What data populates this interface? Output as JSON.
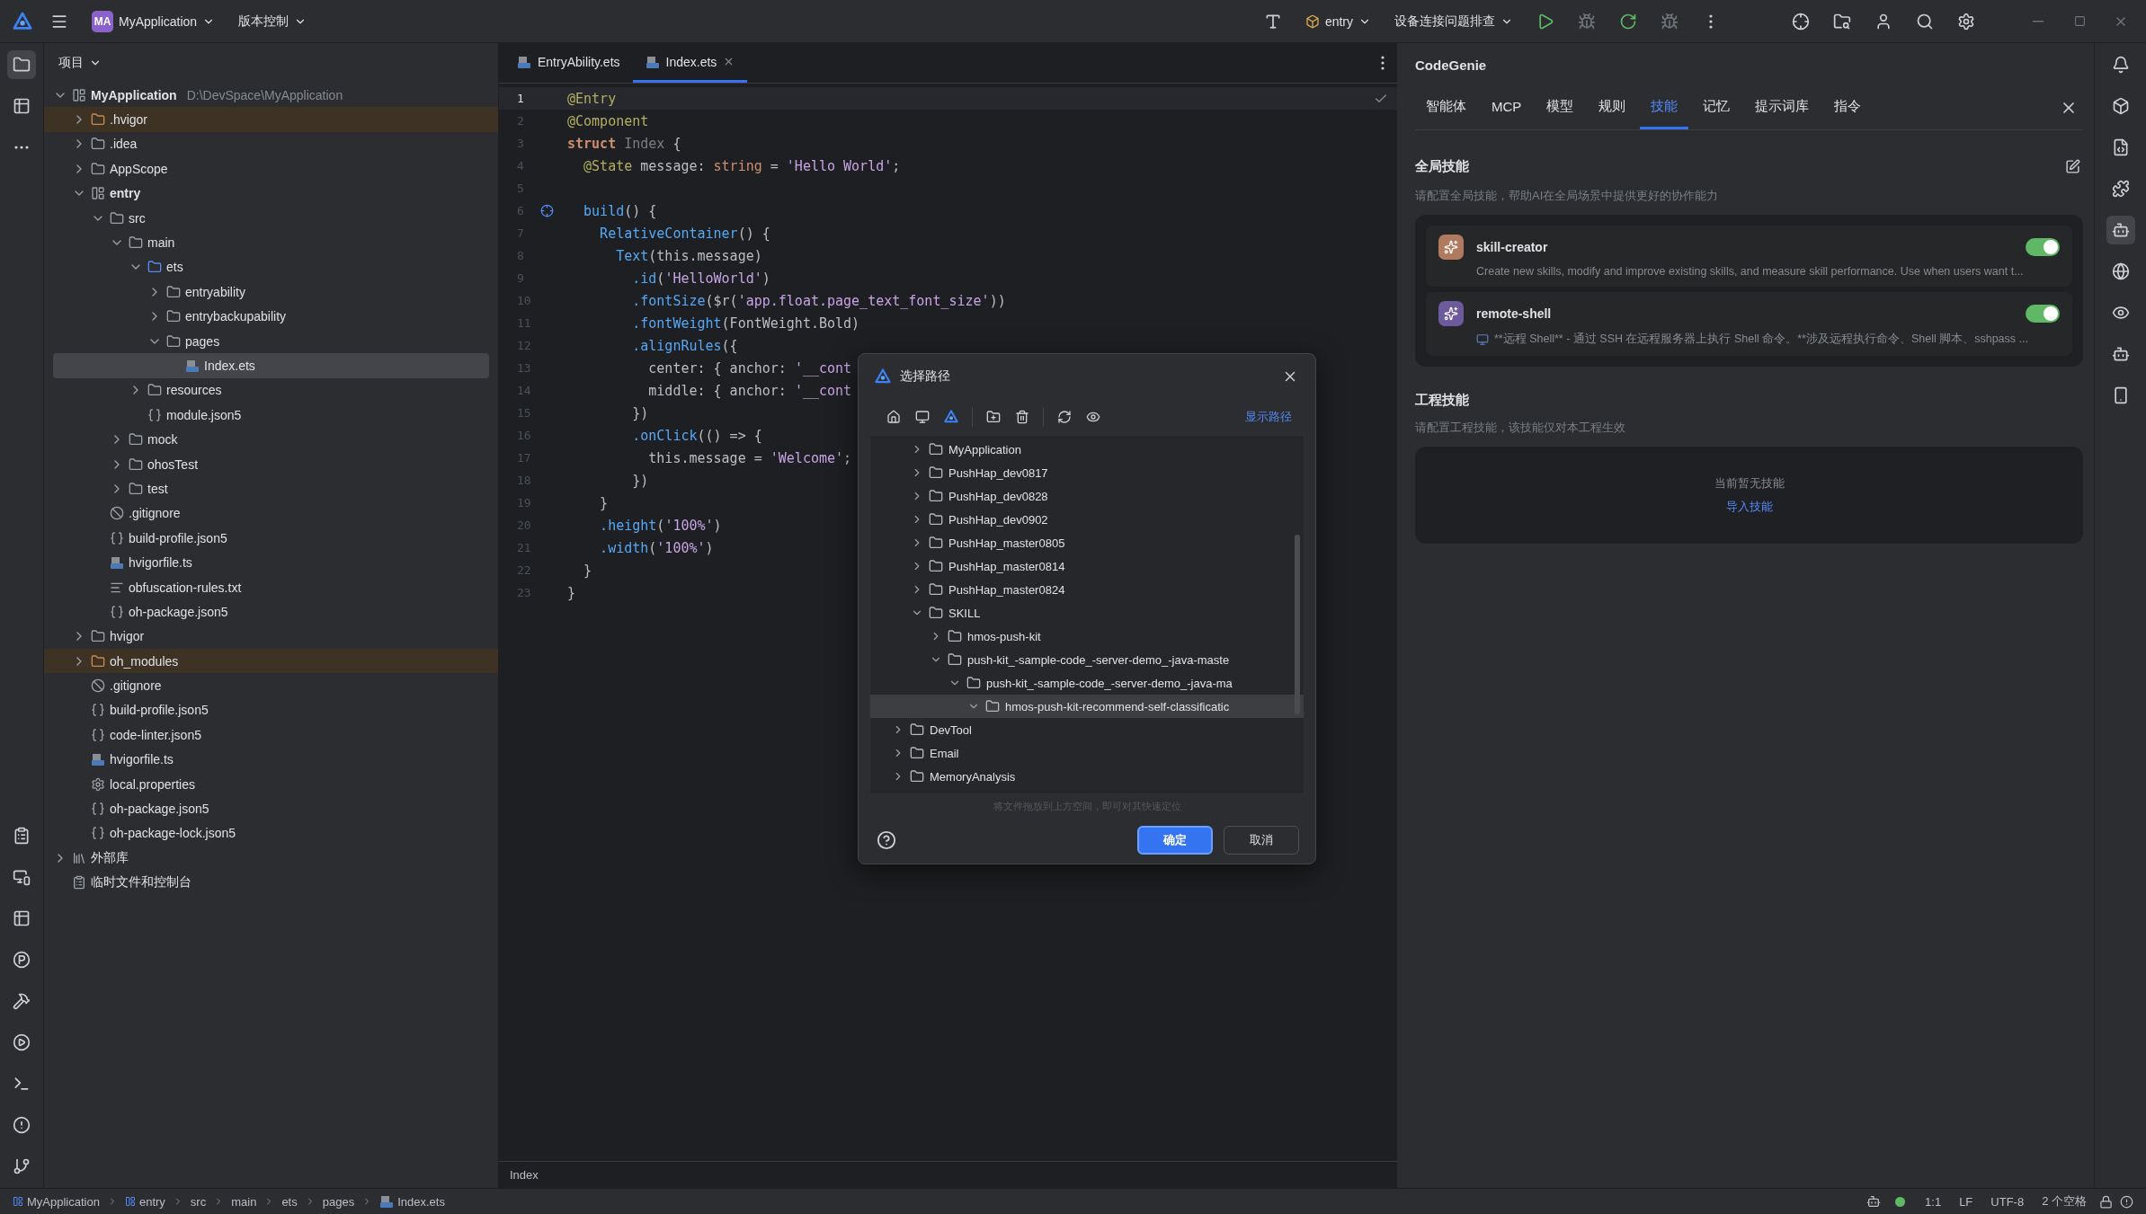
{
  "titlebar": {
    "project_badge": "MA",
    "project": "MyApplication",
    "vcs": "版本控制",
    "run_config": "entry",
    "device": "设备连接问题排查"
  },
  "project_panel": {
    "title": "项目",
    "tree": [
      {
        "name": "MyApplication",
        "kind": "module",
        "path": "D:\\DevSpace\\MyApplication",
        "expanded": true,
        "selected": false,
        "excluded": false,
        "children": [
          {
            "name": ".hvigor",
            "kind": "folder",
            "expanded": false,
            "selected": false,
            "excluded": true
          },
          {
            "name": ".idea",
            "kind": "folder",
            "expanded": false,
            "selected": false,
            "excluded": false
          },
          {
            "name": "AppScope",
            "kind": "folder",
            "expanded": false,
            "selected": false,
            "excluded": false
          },
          {
            "name": "entry",
            "kind": "module",
            "expanded": true,
            "selected": false,
            "excluded": false,
            "children": [
              {
                "name": "src",
                "kind": "folder",
                "expanded": true,
                "selected": false,
                "excluded": false,
                "children": [
                  {
                    "name": "main",
                    "kind": "folder",
                    "expanded": true,
                    "selected": false,
                    "excluded": false,
                    "children": [
                      {
                        "name": "ets",
                        "kind": "source",
                        "expanded": true,
                        "selected": false,
                        "excluded": false,
                        "children": [
                          {
                            "name": "entryability",
                            "kind": "folder",
                            "expanded": false,
                            "selected": false,
                            "excluded": false
                          },
                          {
                            "name": "entrybackupability",
                            "kind": "folder",
                            "expanded": false,
                            "selected": false,
                            "excluded": false
                          },
                          {
                            "name": "pages",
                            "kind": "folder",
                            "expanded": true,
                            "selected": false,
                            "excluded": false,
                            "children": [
                              {
                                "name": "Index.ets",
                                "kind": "ets",
                                "selected": true,
                                "excluded": false
                              }
                            ]
                          }
                        ]
                      },
                      {
                        "name": "resources",
                        "kind": "folder",
                        "expanded": false,
                        "selected": false,
                        "excluded": false
                      },
                      {
                        "name": "module.json5",
                        "kind": "json",
                        "selected": false,
                        "excluded": false
                      }
                    ]
                  },
                  {
                    "name": "mock",
                    "kind": "folder",
                    "expanded": false,
                    "selected": false,
                    "excluded": false
                  },
                  {
                    "name": "ohosTest",
                    "kind": "folder",
                    "expanded": false,
                    "selected": false,
                    "excluded": false
                  },
                  {
                    "name": "test",
                    "kind": "folder",
                    "expanded": false,
                    "selected": false,
                    "excluded": false
                  }
                ]
              },
              {
                "name": ".gitignore",
                "kind": "ignore",
                "selected": false,
                "excluded": false
              },
              {
                "name": "build-profile.json5",
                "kind": "json",
                "selected": false,
                "excluded": false
              },
              {
                "name": "hvigorfile.ts",
                "kind": "ts",
                "selected": false,
                "excluded": false
              },
              {
                "name": "obfuscation-rules.txt",
                "kind": "text",
                "selected": false,
                "excluded": false
              },
              {
                "name": "oh-package.json5",
                "kind": "json",
                "selected": false,
                "excluded": false
              }
            ]
          },
          {
            "name": "hvigor",
            "kind": "folder",
            "expanded": false,
            "selected": false,
            "excluded": false
          },
          {
            "name": "oh_modules",
            "kind": "folder",
            "expanded": false,
            "selected": false,
            "excluded": true
          },
          {
            "name": ".gitignore",
            "kind": "ignore",
            "selected": false,
            "excluded": false
          },
          {
            "name": "build-profile.json5",
            "kind": "json",
            "selected": false,
            "excluded": false
          },
          {
            "name": "code-linter.json5",
            "kind": "json",
            "selected": false,
            "excluded": false
          },
          {
            "name": "hvigorfile.ts",
            "kind": "ts",
            "selected": false,
            "excluded": false
          },
          {
            "name": "local.properties",
            "kind": "settings",
            "selected": false,
            "excluded": false
          },
          {
            "name": "oh-package.json5",
            "kind": "json",
            "selected": false,
            "excluded": false
          },
          {
            "name": "oh-package-lock.json5",
            "kind": "json",
            "selected": false,
            "excluded": false
          }
        ]
      },
      {
        "name": "外部库",
        "kind": "library",
        "expanded": false,
        "selected": false,
        "excluded": false
      },
      {
        "name": "临时文件和控制台",
        "kind": "scratch",
        "selected": false,
        "excluded": false
      }
    ]
  },
  "editor": {
    "tabs": [
      {
        "label": "EntryAbility.ets",
        "selected": false,
        "closable": false
      },
      {
        "label": "Index.ets",
        "selected": true,
        "closable": true
      }
    ],
    "lines": [
      {
        "n": "1",
        "current": true,
        "gutter_icon": false,
        "tokens": [
          {
            "kind": "ann",
            "text": "@Entry"
          }
        ]
      },
      {
        "n": "2",
        "current": false,
        "gutter_icon": false,
        "tokens": [
          {
            "kind": "ann",
            "text": "@Component"
          }
        ]
      },
      {
        "n": "3",
        "current": false,
        "gutter_icon": false,
        "tokens": [
          {
            "kind": "kw",
            "text": "struct"
          },
          {
            "kind": "dim",
            "text": " Index"
          },
          {
            "kind": "txt",
            "text": " {"
          }
        ]
      },
      {
        "n": "4",
        "current": false,
        "gutter_icon": false,
        "tokens": [
          {
            "kind": "ann",
            "text": "  @State"
          },
          {
            "kind": "txt",
            "text": " message: "
          },
          {
            "kind": "kw",
            "text": "string"
          },
          {
            "kind": "txt",
            "text": " = "
          },
          {
            "kind": "str",
            "text": "'Hello World'"
          },
          {
            "kind": "txt",
            "text": ";"
          }
        ]
      },
      {
        "n": "5",
        "current": false,
        "gutter_icon": false
      },
      {
        "n": "6",
        "current": false,
        "gutter_icon": true,
        "tokens": [
          {
            "kind": "fn",
            "text": "  build"
          },
          {
            "kind": "txt",
            "text": "() {"
          }
        ]
      },
      {
        "n": "7",
        "current": false,
        "gutter_icon": false,
        "tokens": [
          {
            "kind": "fn",
            "text": "    RelativeContainer"
          },
          {
            "kind": "txt",
            "text": "() {"
          }
        ]
      },
      {
        "n": "8",
        "current": false,
        "gutter_icon": false,
        "tokens": [
          {
            "kind": "fn",
            "text": "      Text"
          },
          {
            "kind": "txt",
            "text": "(this.message)"
          }
        ]
      },
      {
        "n": "9",
        "current": false,
        "gutter_icon": false,
        "tokens": [
          {
            "kind": "fn",
            "text": "        .id"
          },
          {
            "kind": "txt",
            "text": "("
          },
          {
            "kind": "str",
            "text": "'HelloWorld'"
          },
          {
            "kind": "txt",
            "text": ")"
          }
        ]
      },
      {
        "n": "10",
        "current": false,
        "gutter_icon": false,
        "tokens": [
          {
            "kind": "fn",
            "text": "        .fontSize"
          },
          {
            "kind": "txt",
            "text": "($r("
          },
          {
            "kind": "str",
            "text": "'app.float.page_text_font_size'"
          },
          {
            "kind": "txt",
            "text": "))"
          }
        ]
      },
      {
        "n": "11",
        "current": false,
        "gutter_icon": false,
        "tokens": [
          {
            "kind": "fn",
            "text": "        .fontWeight"
          },
          {
            "kind": "txt",
            "text": "(FontWeight.Bold)"
          }
        ]
      },
      {
        "n": "12",
        "current": false,
        "gutter_icon": false,
        "tokens": [
          {
            "kind": "fn",
            "text": "        .alignRules"
          },
          {
            "kind": "txt",
            "text": "({"
          }
        ]
      },
      {
        "n": "13",
        "current": false,
        "gutter_icon": false,
        "tokens": [
          {
            "kind": "txt",
            "text": "          center: { anchor: "
          },
          {
            "kind": "str",
            "text": "'__cont"
          }
        ]
      },
      {
        "n": "14",
        "current": false,
        "gutter_icon": false,
        "tokens": [
          {
            "kind": "txt",
            "text": "          middle: { anchor: "
          },
          {
            "kind": "str",
            "text": "'__cont"
          }
        ]
      },
      {
        "n": "15",
        "current": false,
        "gutter_icon": false,
        "tokens": [
          {
            "kind": "txt",
            "text": "        })"
          }
        ]
      },
      {
        "n": "16",
        "current": false,
        "gutter_icon": false,
        "tokens": [
          {
            "kind": "fn",
            "text": "        .onClick"
          },
          {
            "kind": "txt",
            "text": "(() => {"
          }
        ]
      },
      {
        "n": "17",
        "current": false,
        "gutter_icon": false,
        "tokens": [
          {
            "kind": "txt",
            "text": "          this.message = "
          },
          {
            "kind": "str",
            "text": "'Welcome'"
          },
          {
            "kind": "txt",
            "text": ";"
          }
        ]
      },
      {
        "n": "18",
        "current": false,
        "gutter_icon": false,
        "tokens": [
          {
            "kind": "txt",
            "text": "        })"
          }
        ]
      },
      {
        "n": "19",
        "current": false,
        "gutter_icon": false,
        "tokens": [
          {
            "kind": "txt",
            "text": "    }"
          }
        ]
      },
      {
        "n": "20",
        "current": false,
        "gutter_icon": false,
        "tokens": [
          {
            "kind": "fn",
            "text": "    .height"
          },
          {
            "kind": "txt",
            "text": "("
          },
          {
            "kind": "str",
            "text": "'100%'"
          },
          {
            "kind": "txt",
            "text": ")"
          }
        ]
      },
      {
        "n": "21",
        "current": false,
        "gutter_icon": false,
        "tokens": [
          {
            "kind": "fn",
            "text": "    .width"
          },
          {
            "kind": "txt",
            "text": "("
          },
          {
            "kind": "str",
            "text": "'100%'"
          },
          {
            "kind": "txt",
            "text": ")"
          }
        ]
      },
      {
        "n": "22",
        "current": false,
        "gutter_icon": false,
        "tokens": [
          {
            "kind": "txt",
            "text": "  }"
          }
        ]
      },
      {
        "n": "23",
        "current": false,
        "gutter_icon": false,
        "tokens": [
          {
            "kind": "txt",
            "text": "}"
          }
        ]
      }
    ],
    "breadcrumb": "Index"
  },
  "dialog": {
    "title": "选择路径",
    "show_path": "显示路径",
    "tree": [
      {
        "name": "MyApplication",
        "expanded": false,
        "selected": false
      },
      {
        "name": "PushHap_dev0817",
        "expanded": false,
        "selected": false
      },
      {
        "name": "PushHap_dev0828",
        "expanded": false,
        "selected": false
      },
      {
        "name": "PushHap_dev0902",
        "expanded": false,
        "selected": false
      },
      {
        "name": "PushHap_master0805",
        "expanded": false,
        "selected": false
      },
      {
        "name": "PushHap_master0814",
        "expanded": false,
        "selected": false
      },
      {
        "name": "PushHap_master0824",
        "expanded": false,
        "selected": false
      },
      {
        "name": "SKILL",
        "expanded": true,
        "selected": false,
        "children": [
          {
            "name": "hmos-push-kit",
            "expanded": false,
            "selected": false
          },
          {
            "name": "push-kit_-sample-code_-server-demo_-java-maste",
            "expanded": true,
            "selected": false,
            "children": [
              {
                "name": "push-kit_-sample-code_-server-demo_-java-ma",
                "expanded": true,
                "selected": false,
                "children": [
                  {
                    "name": "hmos-push-kit-recommend-self-classificatic",
                    "expanded": true,
                    "selected": true
                  }
                ]
              }
            ]
          }
        ]
      }
    ],
    "parent_level_items": [
      {
        "name": "DevTool",
        "expanded": false,
        "selected": false
      },
      {
        "name": "Email",
        "expanded": false,
        "selected": false
      },
      {
        "name": "MemoryAnalysis",
        "expanded": false,
        "selected": false
      }
    ],
    "hint": "将文件拖放到上方空间，即可对其快速定位",
    "ok": "确定",
    "cancel": "取消"
  },
  "assistant": {
    "title": "CodeGenie",
    "tabs": [
      {
        "label": "智能体",
        "selected": false
      },
      {
        "label": "MCP",
        "selected": false
      },
      {
        "label": "模型",
        "selected": false
      },
      {
        "label": "规则",
        "selected": false
      },
      {
        "label": "技能",
        "selected": true
      },
      {
        "label": "记忆",
        "selected": false
      },
      {
        "label": "提示词库",
        "selected": false
      },
      {
        "label": "指令",
        "selected": false
      }
    ],
    "global_skills": {
      "title": "全局技能",
      "description": "请配置全局技能，帮助AI在全局场景中提供更好的协作能力",
      "items": [
        {
          "name": "skill-creator",
          "description": "Create new skills, modify and improve existing skills, and measure skill performance. Use when users want t...",
          "color": "#b07a5e",
          "enabled": true,
          "kind": "plain"
        },
        {
          "name": "remote-shell",
          "description": "**远程 Shell** - 通过 SSH 在远程服务器上执行 Shell 命令。**涉及远程执行命令、Shell 脚本、sshpass ...",
          "color": "#6c5a9c",
          "enabled": true,
          "kind": "computer"
        }
      ]
    },
    "project_skills": {
      "title": "工程技能",
      "description": "请配置工程技能，该技能仅对本工程生效",
      "empty": "当前暂无技能",
      "import": "导入技能"
    }
  },
  "status_bar": {
    "breadcrumb": [
      {
        "label": "MyApplication",
        "kind": "module"
      },
      {
        "label": "entry",
        "kind": "module"
      },
      {
        "label": "src",
        "kind": "plain"
      },
      {
        "label": "main",
        "kind": "plain"
      },
      {
        "label": "ets",
        "kind": "plain"
      },
      {
        "label": "pages",
        "kind": "plain"
      },
      {
        "label": "Index.ets",
        "kind": "ets"
      }
    ],
    "position": "1:1",
    "line_ending": "LF",
    "encoding": "UTF-8",
    "indent": "2 个空格"
  }
}
